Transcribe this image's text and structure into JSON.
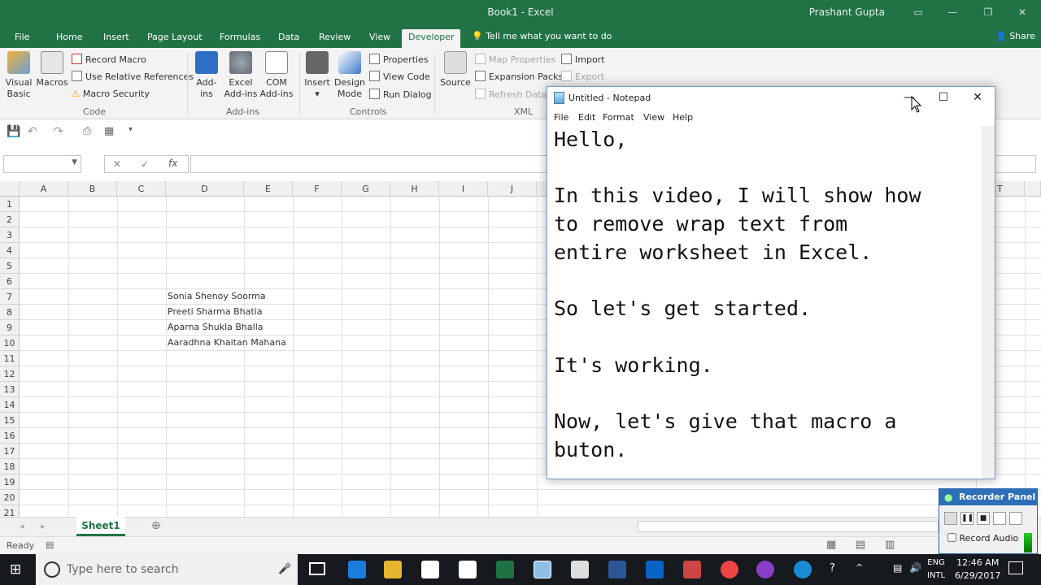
{
  "excel": {
    "title": "Book1  -  Excel",
    "user": "Prashant Gupta",
    "tabs": [
      "File",
      "Home",
      "Insert",
      "Page Layout",
      "Formulas",
      "Data",
      "Review",
      "View",
      "Developer"
    ],
    "tell_me": "Tell me what you want to do",
    "share": "Share",
    "ribbon": {
      "code": {
        "visual_basic": "Visual Basic",
        "macros": "Macros",
        "record_macro": "Record Macro",
        "relative": "Use Relative References",
        "security": "Macro Security",
        "label": "Code"
      },
      "addins": {
        "addins": "Add-ins",
        "excel_addins": "Excel Add-ins",
        "com_addins": "COM Add-ins",
        "label": "Add-ins"
      },
      "controls": {
        "insert": "Insert",
        "design_mode": "Design Mode",
        "properties": "Properties",
        "view_code": "View Code",
        "run_dialog": "Run Dialog",
        "label": "Controls"
      },
      "xml": {
        "source": "Source",
        "map_properties": "Map Properties",
        "expansion_packs": "Expansion Packs",
        "refresh_data": "Refresh Data",
        "import": "Import",
        "export": "Export",
        "label": "XML"
      }
    },
    "columns": [
      "A",
      "B",
      "C",
      "D",
      "E",
      "F",
      "G",
      "H",
      "I",
      "J",
      "T"
    ],
    "rows": [
      "1",
      "2",
      "3",
      "4",
      "5",
      "6",
      "7",
      "8",
      "9",
      "10",
      "11",
      "12",
      "13",
      "14",
      "15",
      "16",
      "17",
      "18",
      "19",
      "20",
      "21"
    ],
    "cells": {
      "d7": "Sonia Shenoy Soorma",
      "d8": "Preeti Sharma Bhatia",
      "d9": "Aparna Shukla Bhalla",
      "d10": "Aaradhna Khaitan Mahana"
    },
    "sheet_tab": "Sheet1",
    "status": "Ready"
  },
  "notepad": {
    "title": "Untitled - Notepad",
    "menu": [
      "File",
      "Edit",
      "Format",
      "View",
      "Help"
    ],
    "text": "Hello,\n\nIn this video, I will show how\nto remove wrap text from\nentire worksheet in Excel.\n\nSo let's get started.\n\nIt's working.\n\nNow, let's give that macro a\nbuton."
  },
  "recorder": {
    "title": "Recorder Panel",
    "record_audio": "Record Audio"
  },
  "taskbar": {
    "search_placeholder": "Type here to search",
    "lang_top": "ENG",
    "lang_bottom": "INTL",
    "time": "12:46 AM",
    "date": "6/29/2017"
  },
  "colors": {
    "excel_green": "#217346",
    "taskbar": "#16191e",
    "recorder_blue": "#2d6eb8"
  }
}
